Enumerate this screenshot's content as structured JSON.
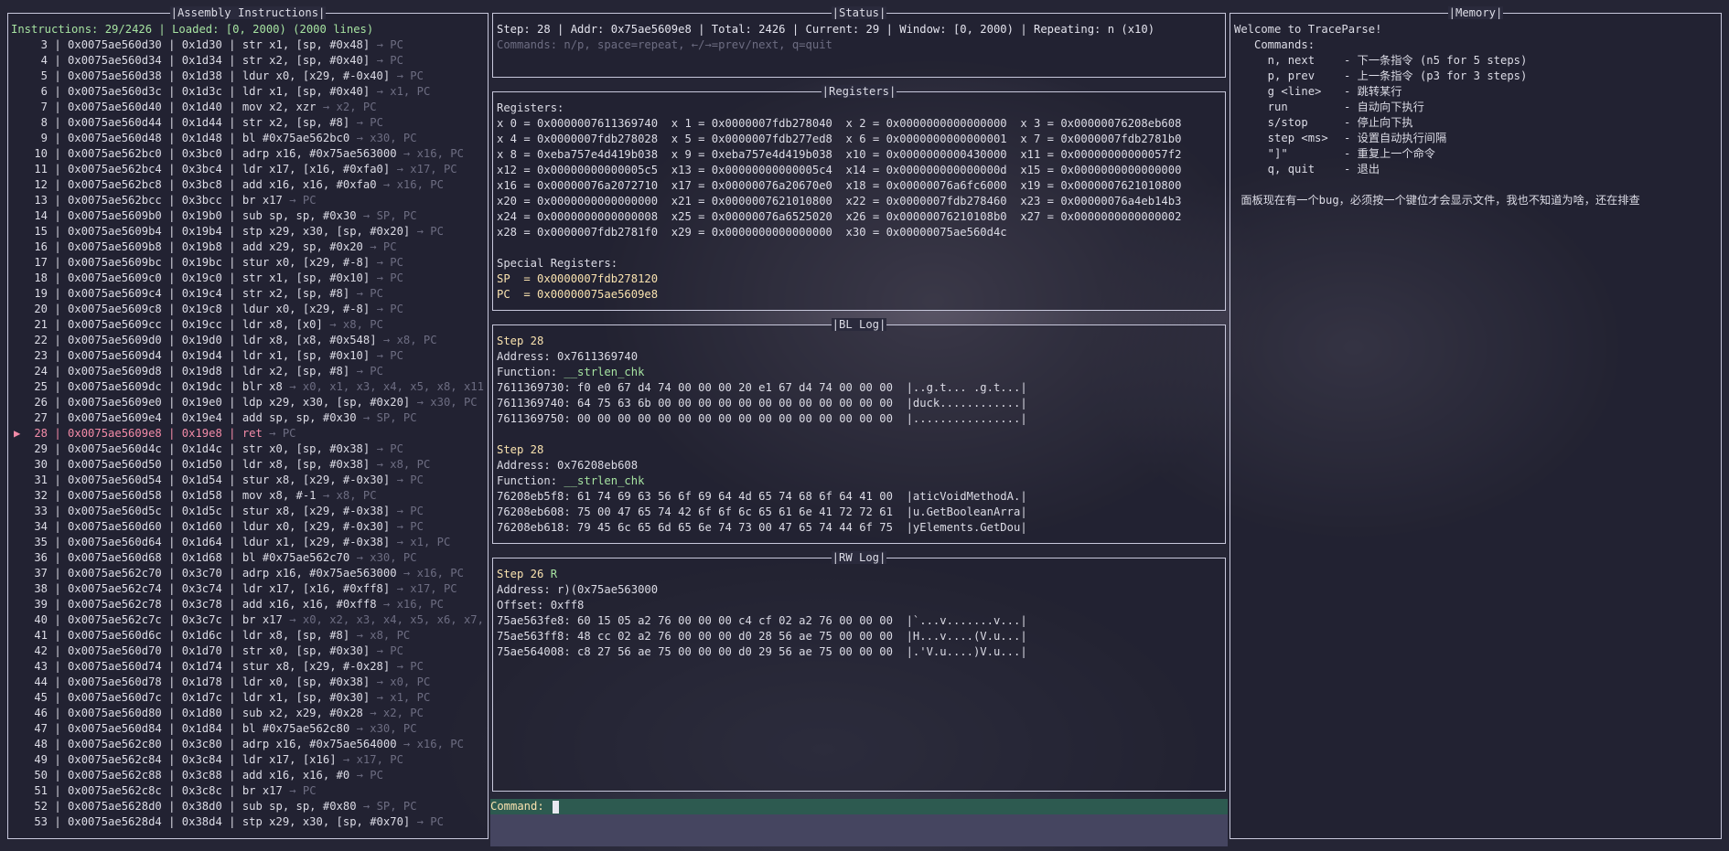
{
  "panels": {
    "assembly": "|Assembly Instructions|",
    "status": "|Status|",
    "registers": "|Registers|",
    "bl_log": "|BL Log|",
    "rw_log": "|RW Log|",
    "memory": "|Memory|"
  },
  "assembly": {
    "header": "Instructions: 29/2426 | Loaded: [0, 2000) (2000 lines)",
    "current_marker": "▶",
    "rows": [
      {
        "n": "3",
        "addr": "0x0075ae560d30",
        "off": "0x1d30",
        "ins": "str x1, [sp, #0x48]",
        "note": "→ PC"
      },
      {
        "n": "4",
        "addr": "0x0075ae560d34",
        "off": "0x1d34",
        "ins": "str x2, [sp, #0x40]",
        "note": "→ PC"
      },
      {
        "n": "5",
        "addr": "0x0075ae560d38",
        "off": "0x1d38",
        "ins": "ldur x0, [x29, #-0x40]",
        "note": "→ PC"
      },
      {
        "n": "6",
        "addr": "0x0075ae560d3c",
        "off": "0x1d3c",
        "ins": "ldr x1, [sp, #0x40]",
        "note": "→ x1, PC"
      },
      {
        "n": "7",
        "addr": "0x0075ae560d40",
        "off": "0x1d40",
        "ins": "mov x2, xzr",
        "note": "→ x2, PC"
      },
      {
        "n": "8",
        "addr": "0x0075ae560d44",
        "off": "0x1d44",
        "ins": "str x2, [sp, #8]",
        "note": "→ PC"
      },
      {
        "n": "9",
        "addr": "0x0075ae560d48",
        "off": "0x1d48",
        "ins": "bl #0x75ae562bc0",
        "note": "→ x30, PC"
      },
      {
        "n": "10",
        "addr": "0x0075ae562bc0",
        "off": "0x3bc0",
        "ins": "adrp x16, #0x75ae563000",
        "note": "→ x16, PC"
      },
      {
        "n": "11",
        "addr": "0x0075ae562bc4",
        "off": "0x3bc4",
        "ins": "ldr x17, [x16, #0xfa0]",
        "note": "→ x17, PC"
      },
      {
        "n": "12",
        "addr": "0x0075ae562bc8",
        "off": "0x3bc8",
        "ins": "add x16, x16, #0xfa0",
        "note": "→ x16, PC"
      },
      {
        "n": "13",
        "addr": "0x0075ae562bcc",
        "off": "0x3bcc",
        "ins": "br x17",
        "note": "→ PC"
      },
      {
        "n": "14",
        "addr": "0x0075ae5609b0",
        "off": "0x19b0",
        "ins": "sub sp, sp, #0x30",
        "note": "→ SP, PC"
      },
      {
        "n": "15",
        "addr": "0x0075ae5609b4",
        "off": "0x19b4",
        "ins": "stp x29, x30, [sp, #0x20]",
        "note": "→ PC"
      },
      {
        "n": "16",
        "addr": "0x0075ae5609b8",
        "off": "0x19b8",
        "ins": "add x29, sp, #0x20",
        "note": "→ PC"
      },
      {
        "n": "17",
        "addr": "0x0075ae5609bc",
        "off": "0x19bc",
        "ins": "stur x0, [x29, #-8]",
        "note": "→ PC"
      },
      {
        "n": "18",
        "addr": "0x0075ae5609c0",
        "off": "0x19c0",
        "ins": "str x1, [sp, #0x10]",
        "note": "→ PC"
      },
      {
        "n": "19",
        "addr": "0x0075ae5609c4",
        "off": "0x19c4",
        "ins": "str x2, [sp, #8]",
        "note": "→ PC"
      },
      {
        "n": "20",
        "addr": "0x0075ae5609c8",
        "off": "0x19c8",
        "ins": "ldur x0, [x29, #-8]",
        "note": "→ PC"
      },
      {
        "n": "21",
        "addr": "0x0075ae5609cc",
        "off": "0x19cc",
        "ins": "ldr x8, [x0]",
        "note": "→ x8, PC"
      },
      {
        "n": "22",
        "addr": "0x0075ae5609d0",
        "off": "0x19d0",
        "ins": "ldr x8, [x8, #0x548]",
        "note": "→ x8, PC"
      },
      {
        "n": "23",
        "addr": "0x0075ae5609d4",
        "off": "0x19d4",
        "ins": "ldr x1, [sp, #0x10]",
        "note": "→ PC"
      },
      {
        "n": "24",
        "addr": "0x0075ae5609d8",
        "off": "0x19d8",
        "ins": "ldr x2, [sp, #8]",
        "note": "→ PC"
      },
      {
        "n": "25",
        "addr": "0x0075ae5609dc",
        "off": "0x19dc",
        "ins": "blr x8",
        "note": "→ x0, x1, x3, x4, x5, x8, x11, x"
      },
      {
        "n": "26",
        "addr": "0x0075ae5609e0",
        "off": "0x19e0",
        "ins": "ldp x29, x30, [sp, #0x20]",
        "note": "→ x30, PC"
      },
      {
        "n": "27",
        "addr": "0x0075ae5609e4",
        "off": "0x19e4",
        "ins": "add sp, sp, #0x30",
        "note": "→ SP, PC"
      },
      {
        "n": "28",
        "addr": "0x0075ae5609e8",
        "off": "0x19e8",
        "ins": "ret",
        "note": "→ PC",
        "current": true
      },
      {
        "n": "29",
        "addr": "0x0075ae560d4c",
        "off": "0x1d4c",
        "ins": "str x0, [sp, #0x38]",
        "note": "→ PC"
      },
      {
        "n": "30",
        "addr": "0x0075ae560d50",
        "off": "0x1d50",
        "ins": "ldr x8, [sp, #0x38]",
        "note": "→ x8, PC"
      },
      {
        "n": "31",
        "addr": "0x0075ae560d54",
        "off": "0x1d54",
        "ins": "stur x8, [x29, #-0x30]",
        "note": "→ PC"
      },
      {
        "n": "32",
        "addr": "0x0075ae560d58",
        "off": "0x1d58",
        "ins": "mov x8, #-1",
        "note": "→ x8, PC"
      },
      {
        "n": "33",
        "addr": "0x0075ae560d5c",
        "off": "0x1d5c",
        "ins": "stur x8, [x29, #-0x38]",
        "note": "→ PC"
      },
      {
        "n": "34",
        "addr": "0x0075ae560d60",
        "off": "0x1d60",
        "ins": "ldur x0, [x29, #-0x30]",
        "note": "→ PC"
      },
      {
        "n": "35",
        "addr": "0x0075ae560d64",
        "off": "0x1d64",
        "ins": "ldur x1, [x29, #-0x38]",
        "note": "→ x1, PC"
      },
      {
        "n": "36",
        "addr": "0x0075ae560d68",
        "off": "0x1d68",
        "ins": "bl #0x75ae562c70",
        "note": "→ x30, PC"
      },
      {
        "n": "37",
        "addr": "0x0075ae562c70",
        "off": "0x3c70",
        "ins": "adrp x16, #0x75ae563000",
        "note": "→ x16, PC"
      },
      {
        "n": "38",
        "addr": "0x0075ae562c74",
        "off": "0x3c74",
        "ins": "ldr x17, [x16, #0xff8]",
        "note": "→ x17, PC"
      },
      {
        "n": "39",
        "addr": "0x0075ae562c78",
        "off": "0x3c78",
        "ins": "add x16, x16, #0xff8",
        "note": "→ x16, PC"
      },
      {
        "n": "40",
        "addr": "0x0075ae562c7c",
        "off": "0x3c7c",
        "ins": "br x17",
        "note": "→ x0, x2, x3, x4, x5, x6, x7, x8"
      },
      {
        "n": "41",
        "addr": "0x0075ae560d6c",
        "off": "0x1d6c",
        "ins": "ldr x8, [sp, #8]",
        "note": "→ x8, PC"
      },
      {
        "n": "42",
        "addr": "0x0075ae560d70",
        "off": "0x1d70",
        "ins": "str x0, [sp, #0x30]",
        "note": "→ PC"
      },
      {
        "n": "43",
        "addr": "0x0075ae560d74",
        "off": "0x1d74",
        "ins": "stur x8, [x29, #-0x28]",
        "note": "→ PC"
      },
      {
        "n": "44",
        "addr": "0x0075ae560d78",
        "off": "0x1d78",
        "ins": "ldr x0, [sp, #0x38]",
        "note": "→ x0, PC"
      },
      {
        "n": "45",
        "addr": "0x0075ae560d7c",
        "off": "0x1d7c",
        "ins": "ldr x1, [sp, #0x30]",
        "note": "→ x1, PC"
      },
      {
        "n": "46",
        "addr": "0x0075ae560d80",
        "off": "0x1d80",
        "ins": "sub x2, x29, #0x28",
        "note": "→ x2, PC"
      },
      {
        "n": "47",
        "addr": "0x0075ae560d84",
        "off": "0x1d84",
        "ins": "bl #0x75ae562c80",
        "note": "→ x30, PC"
      },
      {
        "n": "48",
        "addr": "0x0075ae562c80",
        "off": "0x3c80",
        "ins": "adrp x16, #0x75ae564000",
        "note": "→ x16, PC"
      },
      {
        "n": "49",
        "addr": "0x0075ae562c84",
        "off": "0x3c84",
        "ins": "ldr x17, [x16]",
        "note": "→ x17, PC"
      },
      {
        "n": "50",
        "addr": "0x0075ae562c88",
        "off": "0x3c88",
        "ins": "add x16, x16, #0",
        "note": "→ PC"
      },
      {
        "n": "51",
        "addr": "0x0075ae562c8c",
        "off": "0x3c8c",
        "ins": "br x17",
        "note": "→ PC"
      },
      {
        "n": "52",
        "addr": "0x0075ae5628d0",
        "off": "0x38d0",
        "ins": "sub sp, sp, #0x80",
        "note": "→ SP, PC"
      },
      {
        "n": "53",
        "addr": "0x0075ae5628d4",
        "off": "0x38d4",
        "ins": "stp x29, x30, [sp, #0x70]",
        "note": "→ PC"
      }
    ]
  },
  "status": {
    "line1": "Step: 28 | Addr: 0x75ae5609e8 | Total: 2426 | Current: 29 | Window: [0, 2000) | Repeating: n (x10)",
    "line2": "Commands: n/p, space=repeat, ←/→=prev/next, q=quit"
  },
  "registers": {
    "title": "Registers:",
    "lines": [
      "x 0 = 0x0000007611369740  x 1 = 0x0000007fdb278040  x 2 = 0x0000000000000000  x 3 = 0x00000076208eb608",
      "x 4 = 0x0000007fdb278028  x 5 = 0x0000007fdb277ed8  x 6 = 0x0000000000000001  x 7 = 0x0000007fdb2781b0",
      "x 8 = 0xeba757e4d419b038  x 9 = 0xeba757e4d419b038  x10 = 0x0000000000430000  x11 = 0x00000000000057f2",
      "x12 = 0x00000000000005c5  x13 = 0x00000000000005c4  x14 = 0x000000000000000d  x15 = 0x0000000000000000",
      "x16 = 0x00000076a2072710  x17 = 0x00000076a20670e0  x18 = 0x00000076a6fc6000  x19 = 0x0000007621010800",
      "x20 = 0x0000000000000000  x21 = 0x0000007621010800  x22 = 0x0000007fdb278460  x23 = 0x00000076a4eb14b3",
      "x24 = 0x0000000000000008  x25 = 0x00000076a6525020  x26 = 0x00000076210108b0  x27 = 0x0000000000000002",
      "x28 = 0x0000007fdb2781f0  x29 = 0x0000000000000000  x30 = 0x00000075ae560d4c"
    ],
    "special_title": "Special Registers:",
    "sp": "SP  = 0x0000007fdb278120",
    "pc": "PC  = 0x00000075ae5609e8"
  },
  "bl_log": {
    "entries": [
      {
        "step": "Step 28",
        "address": "Address: 0x7611369740",
        "function_label": "Function: ",
        "function": "__strlen_chk",
        "dump": [
          "7611369730: f0 e0 67 d4 74 00 00 00 20 e1 67 d4 74 00 00 00  |..g.t... .g.t...|",
          "7611369740: 64 75 63 6b 00 00 00 00 00 00 00 00 00 00 00 00  |duck............|",
          "7611369750: 00 00 00 00 00 00 00 00 00 00 00 00 00 00 00 00  |................|"
        ]
      },
      {
        "step": "Step 28",
        "address": "Address: 0x76208eb608",
        "function_label": "Function: ",
        "function": "__strlen_chk",
        "dump": [
          "76208eb5f8: 61 74 69 63 56 6f 69 64 4d 65 74 68 6f 64 41 00  |aticVoidMethodA.|",
          "76208eb608: 75 00 47 65 74 42 6f 6f 6c 65 61 6e 41 72 72 61  |u.GetBooleanArra|",
          "76208eb618: 79 45 6c 65 6d 65 6e 74 73 00 47 65 74 44 6f 75  |yElements.GetDou|"
        ]
      }
    ]
  },
  "rw_log": {
    "step": "Step 26 ",
    "mode": "R",
    "address": "Address: r)(0x75ae563000",
    "offset": "Offset: 0xff8",
    "dump": [
      "75ae563fe8: 60 15 05 a2 76 00 00 00 c4 cf 02 a2 76 00 00 00  |`...v.......v...|",
      "75ae563ff8: 48 cc 02 a2 76 00 00 00 d0 28 56 ae 75 00 00 00  |H...v....(V.u...|",
      "75ae564008: c8 27 56 ae 75 00 00 00 d0 29 56 ae 75 00 00 00  |.'V.u....)V.u...|"
    ]
  },
  "memory": {
    "welcome": "Welcome to TraceParse!",
    "commands_title": "   Commands:",
    "commands": [
      {
        "cmd": "     n, next",
        "desc": "- 下一条指令 (n5 for 5 steps)"
      },
      {
        "cmd": "     p, prev",
        "desc": "- 上一条指令 (p3 for 3 steps)"
      },
      {
        "cmd": "     g <line>",
        "desc": "- 跳转某行"
      },
      {
        "cmd": "     run",
        "desc": "- 自动向下执行"
      },
      {
        "cmd": "     s/stop",
        "desc": "- 停止向下执"
      },
      {
        "cmd": "     step <ms>",
        "desc": "- 设置自动执行间隔"
      },
      {
        "cmd": "     \"]\"",
        "desc": "- 重复上一个命令"
      },
      {
        "cmd": "     q, quit",
        "desc": "- 退出"
      }
    ],
    "note": " 面板现在有一个bug，必须按一个键位才会显示文件，我也不知道为啥，还在排查"
  },
  "command": {
    "label": "Command: ",
    "value": ""
  }
}
